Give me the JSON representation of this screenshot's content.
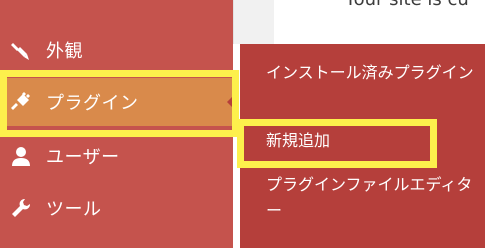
{
  "header": {
    "site_text": "Your site is cu"
  },
  "sidebar": {
    "items": [
      {
        "label": "外観",
        "icon": "paintbrush-icon",
        "active": false
      },
      {
        "label": "プラグイン",
        "icon": "plug-icon",
        "active": true
      },
      {
        "label": "ユーザー",
        "icon": "user-icon",
        "active": false
      },
      {
        "label": "ツール",
        "icon": "wrench-icon",
        "active": false
      }
    ]
  },
  "flyout": {
    "items": [
      {
        "label": "インストール済みプラグイン"
      },
      {
        "label": "新規追加"
      },
      {
        "label": "プラグインファイルエディター"
      }
    ]
  },
  "colors": {
    "sidebar_bg": "#c5534d",
    "active_bg": "#d98a4b",
    "flyout_bg": "#b53f3b",
    "highlight": "#fdf04c"
  }
}
